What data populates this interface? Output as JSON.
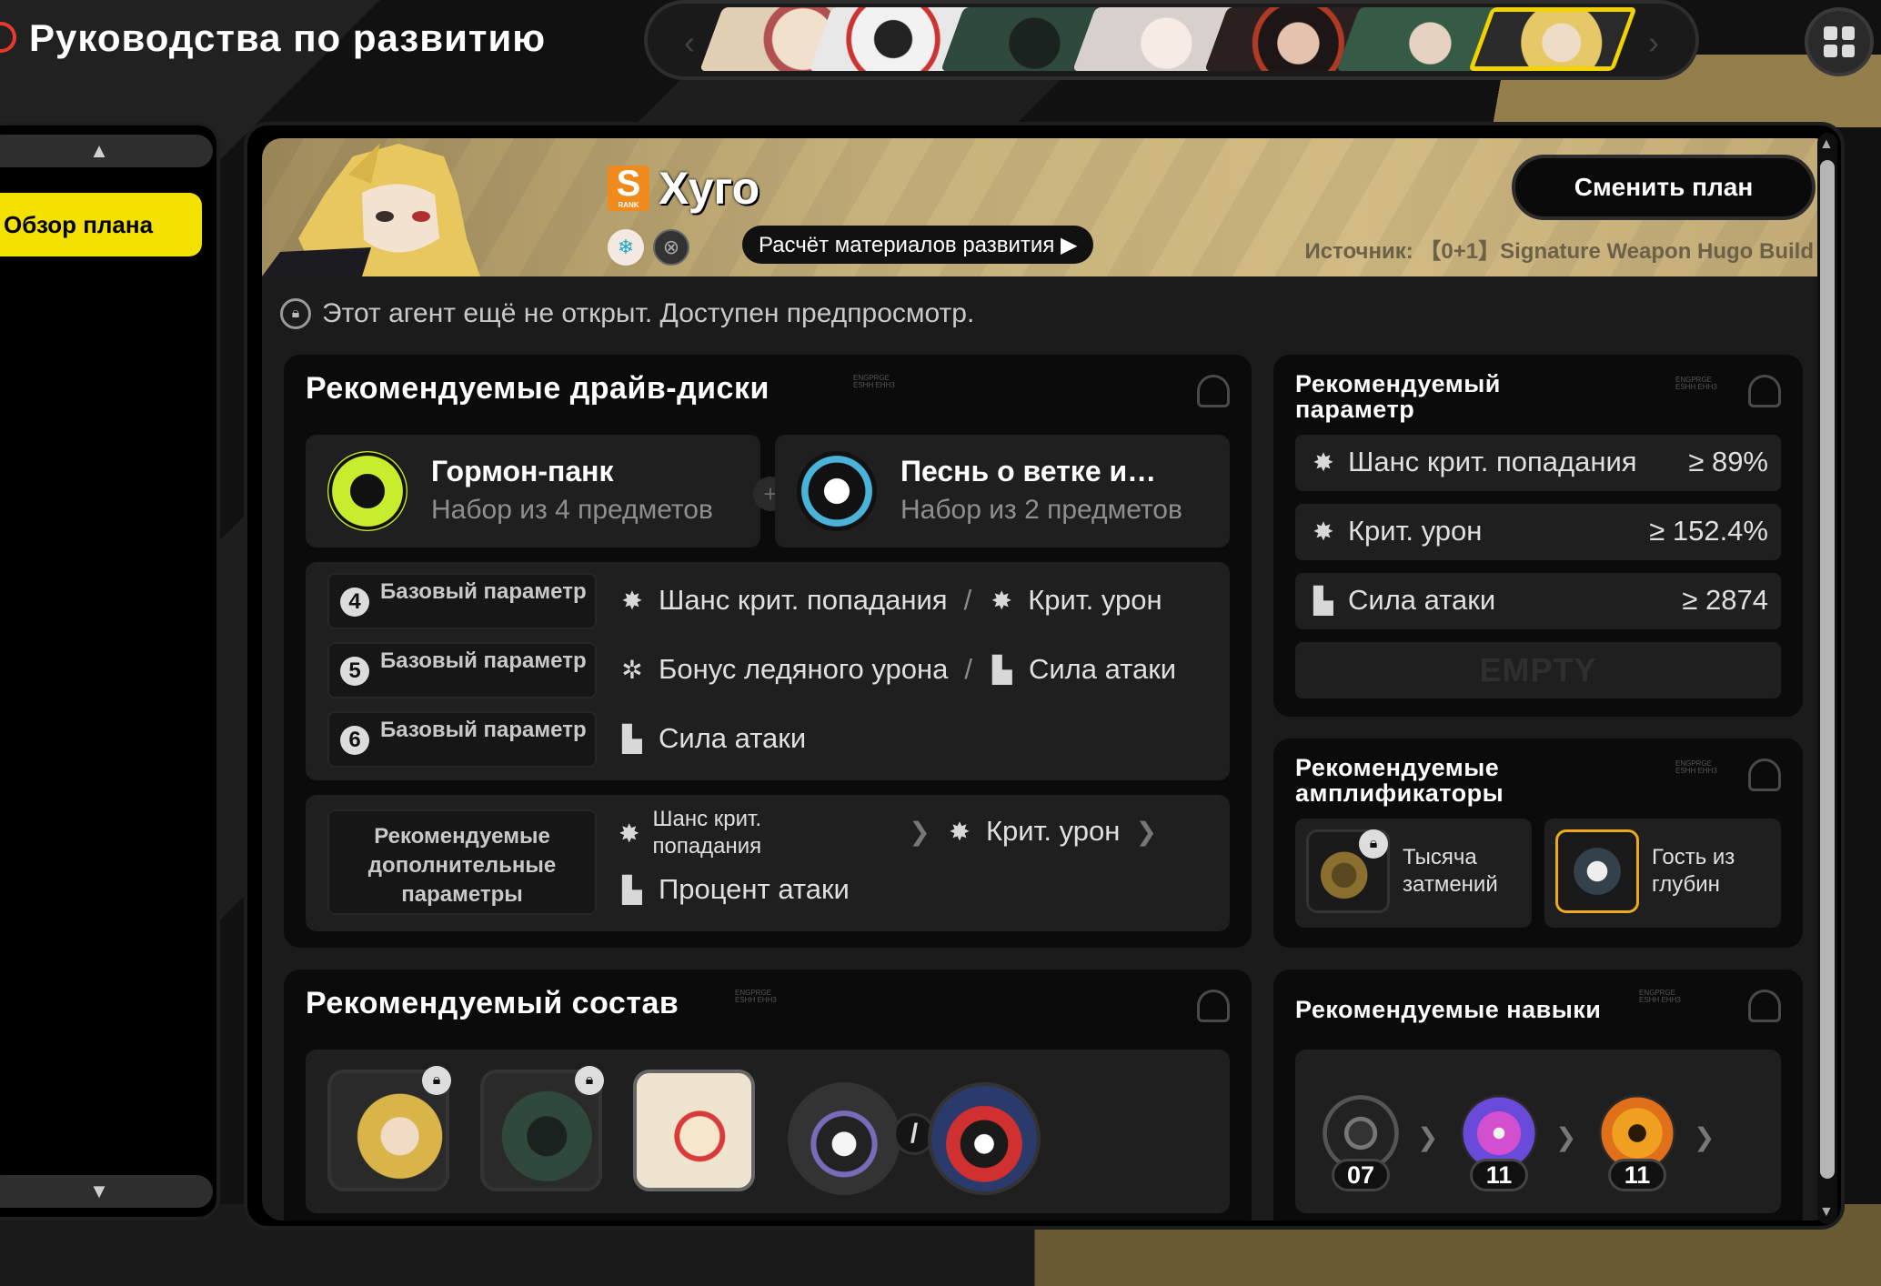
{
  "page": {
    "title": "Руководства по развитию"
  },
  "agent_strip": {
    "prev": "‹",
    "next": "›"
  },
  "sidebar": {
    "active_item": "Обзор плана"
  },
  "agent": {
    "rank": "S",
    "rank_sub": "RANK",
    "name": "Хуго",
    "calc_button": "Расчёт материалов развития ▶",
    "change_plan": "Сменить план",
    "source": "Источник: 【0+1】Signature Weapon Hugo Build",
    "locked_note": "Этот агент ещё не открыт. Доступен предпросмотр."
  },
  "drive_discs": {
    "title": "Рекомендуемые драйв-диски",
    "set1": {
      "name": "Гормон-панк",
      "sub": "Набор из 4 предметов"
    },
    "set2": {
      "name": "Песнь о ветке и…",
      "sub": "Набор из 2 предметов"
    },
    "slots": [
      {
        "num": "4",
        "label": "Базовый параметр",
        "stat1": "Шанс крит. попадания",
        "stat2": "Крит. урон"
      },
      {
        "num": "5",
        "label": "Базовый параметр",
        "stat1": "Бонус ледяного урона",
        "stat2": "Сила атаки"
      },
      {
        "num": "6",
        "label": "Базовый параметр",
        "stat1": "Сила атаки"
      }
    ],
    "substats": {
      "label": "Рекомендуемые дополнительные параметры",
      "s1": "Шанс крит. попадания",
      "s2": "Крит. урон",
      "s3": "Процент атаки"
    }
  },
  "rec_params": {
    "title": "Рекомендуемый параметр",
    "rows": [
      {
        "name": "Шанс крит. попадания",
        "value": "≥ 89%"
      },
      {
        "name": "Крит. урон",
        "value": "≥ 152.4%"
      },
      {
        "name": "Сила атаки",
        "value": "≥ 2874"
      }
    ],
    "empty": "EMPTY"
  },
  "amplifiers": {
    "title": "Рекомендуемые амплификаторы",
    "items": [
      {
        "name": "Тысяча затмений"
      },
      {
        "name": "Гость из глубин"
      }
    ]
  },
  "team": {
    "title": "Рекомендуемый состав",
    "slash": "/"
  },
  "skills": {
    "title": "Рекомендуемые навыки",
    "levels": [
      "07",
      "11",
      "11"
    ]
  },
  "card_tag": "ENGPRGE ESHH EHH3",
  "colors": {
    "accent_yellow": "#f5e100",
    "rank_orange": "#f08a1c",
    "banner_gold": "#c8b27d"
  }
}
